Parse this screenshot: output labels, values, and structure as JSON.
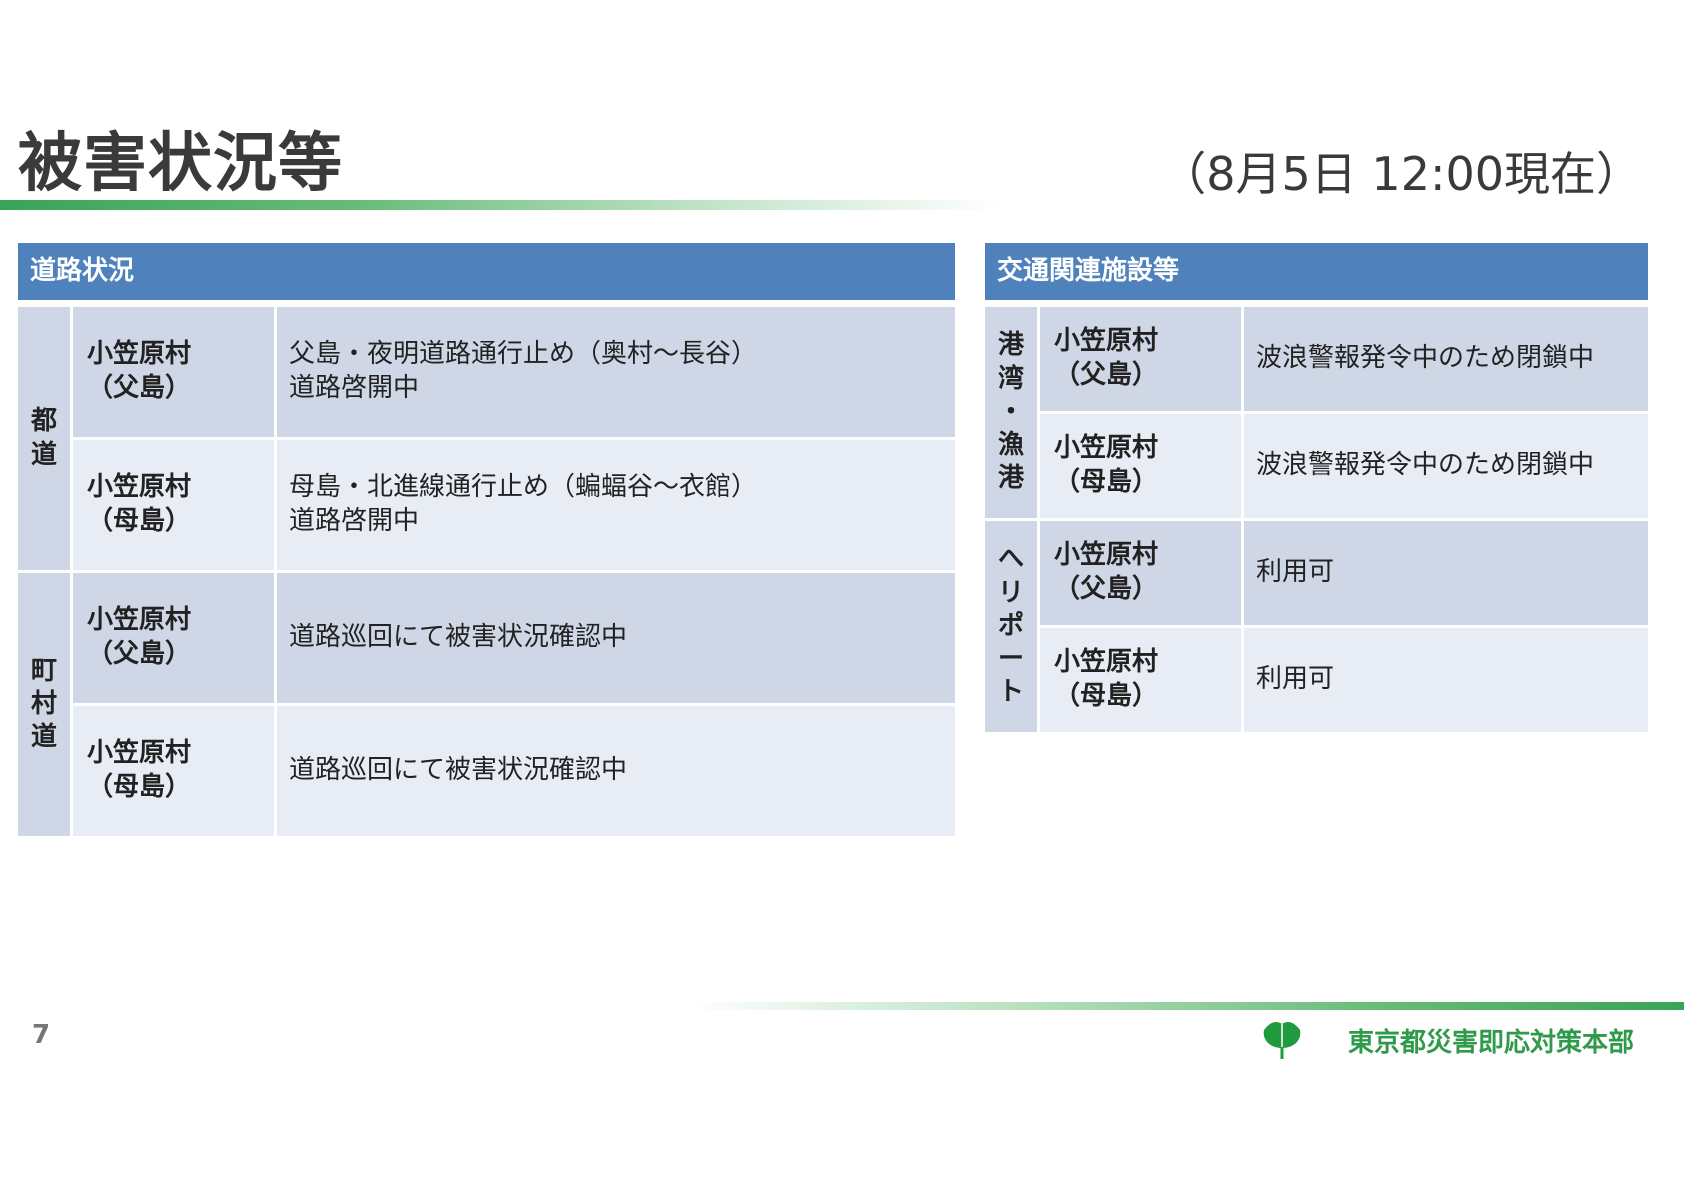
{
  "page": {
    "title": "被害状況等",
    "timestamp": "（8月5日 12:00現在）",
    "page_number": "7",
    "organization": "東京都災害即応対策本部",
    "colors": {
      "header_blue": "#4f81bd",
      "row_dark": "#cfd7e6",
      "row_light": "#e8edf5",
      "accent_green": "#3aa35a",
      "logo_green": "#1f9a3e"
    }
  },
  "roads": {
    "header": "道路状況",
    "groups": [
      {
        "category": [
          "都",
          "道"
        ],
        "rows": [
          {
            "location": [
              "小笠原村",
              "（父島）"
            ],
            "status": [
              "父島・夜明道路通行止め（奥村～長谷）",
              "道路啓開中"
            ]
          },
          {
            "location": [
              "小笠原村",
              "（母島）"
            ],
            "status": [
              "母島・北進線通行止め（蝙蝠谷～衣館）",
              "道路啓開中"
            ]
          }
        ]
      },
      {
        "category": [
          "町",
          "村",
          "道"
        ],
        "rows": [
          {
            "location": [
              "小笠原村",
              "（父島）"
            ],
            "status": [
              "道路巡回にて被害状況確認中"
            ]
          },
          {
            "location": [
              "小笠原村",
              "（母島）"
            ],
            "status": [
              "道路巡回にて被害状況確認中"
            ]
          }
        ]
      }
    ]
  },
  "transport": {
    "header": "交通関連施設等",
    "groups": [
      {
        "category": [
          "港",
          "湾",
          "・",
          "漁",
          "港"
        ],
        "rows": [
          {
            "location": [
              "小笠原村",
              "（父島）"
            ],
            "status": [
              "波浪警報発令中のため閉鎖中"
            ]
          },
          {
            "location": [
              "小笠原村",
              "（母島）"
            ],
            "status": [
              "波浪警報発令中のため閉鎖中"
            ]
          }
        ]
      },
      {
        "category": [
          "へ",
          "リ",
          "ポ",
          "ー",
          "ト"
        ],
        "rows": [
          {
            "location": [
              "小笠原村",
              "（父島）"
            ],
            "status": [
              "利用可"
            ]
          },
          {
            "location": [
              "小笠原村",
              "（母島）"
            ],
            "status": [
              "利用可"
            ]
          }
        ]
      }
    ]
  }
}
